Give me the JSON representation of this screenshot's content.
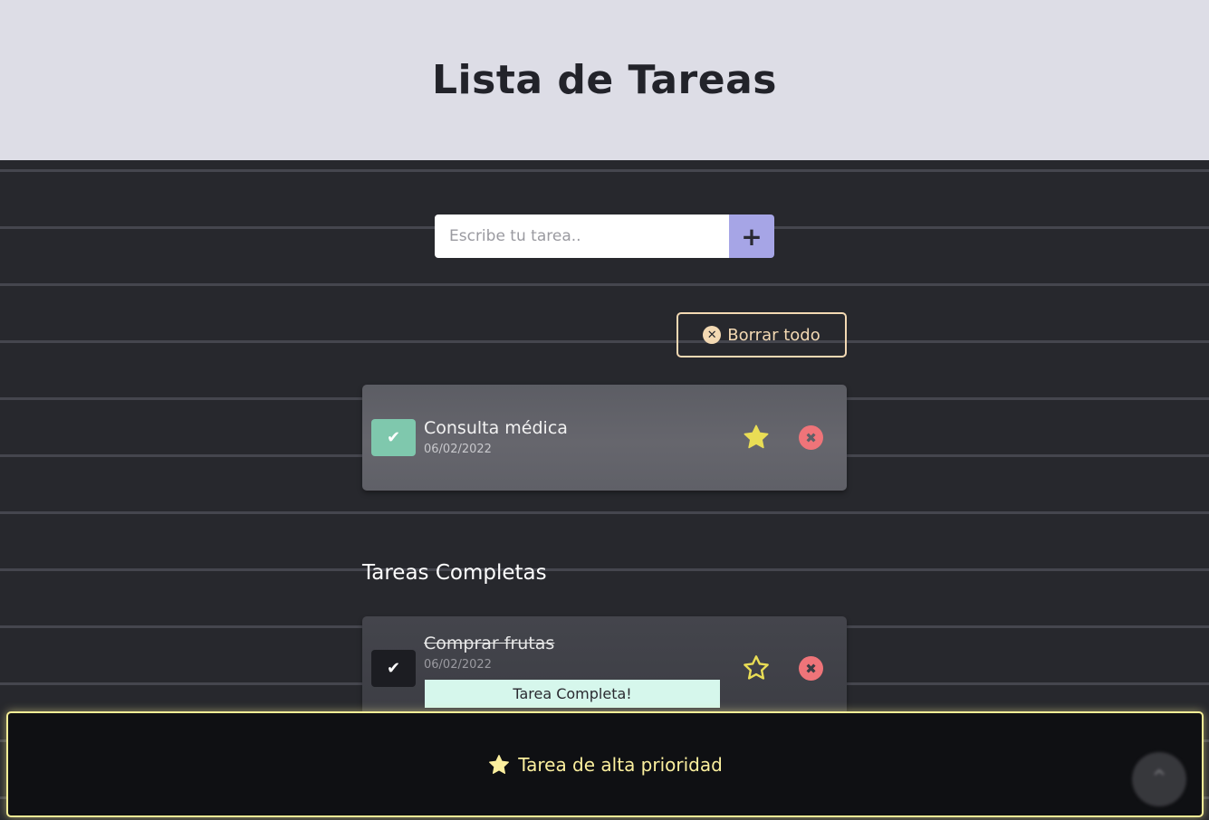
{
  "header": {
    "title": "Lista de Tareas"
  },
  "form": {
    "placeholder": "Escribe tu tarea..",
    "add_label": "+"
  },
  "clear_all": {
    "icon": "x-circle-icon",
    "label": "Borrar todo"
  },
  "pending_tasks": [
    {
      "title": "Consulta médica",
      "date": "06/02/2022",
      "priority": true,
      "check_glyph": "✔",
      "delete_glyph": "✖"
    }
  ],
  "completed_section": {
    "title": "Tareas Completas"
  },
  "completed_tasks": [
    {
      "title": "Comprar frutas",
      "date": "06/02/2022",
      "priority": false,
      "badge": "Tarea Completa!",
      "check_glyph": "✔",
      "delete_glyph": "✖"
    }
  ],
  "toast": {
    "icon": "star-icon",
    "message": "Tarea de alta prioridad"
  },
  "scroll_top": {
    "icon": "chevron-up-icon",
    "glyph": "⌃"
  },
  "colors": {
    "header_bg": "#dddde6",
    "page_bg": "#27282d",
    "add_button": "#a6a5e6",
    "accent_peach": "#f3d9b3",
    "check_green": "#7fc8ad",
    "star_yellow": "#e9dd55",
    "delete_red": "#ef7479",
    "badge_mint": "#d6f7ec",
    "toast_yellow": "#f7ee96"
  }
}
